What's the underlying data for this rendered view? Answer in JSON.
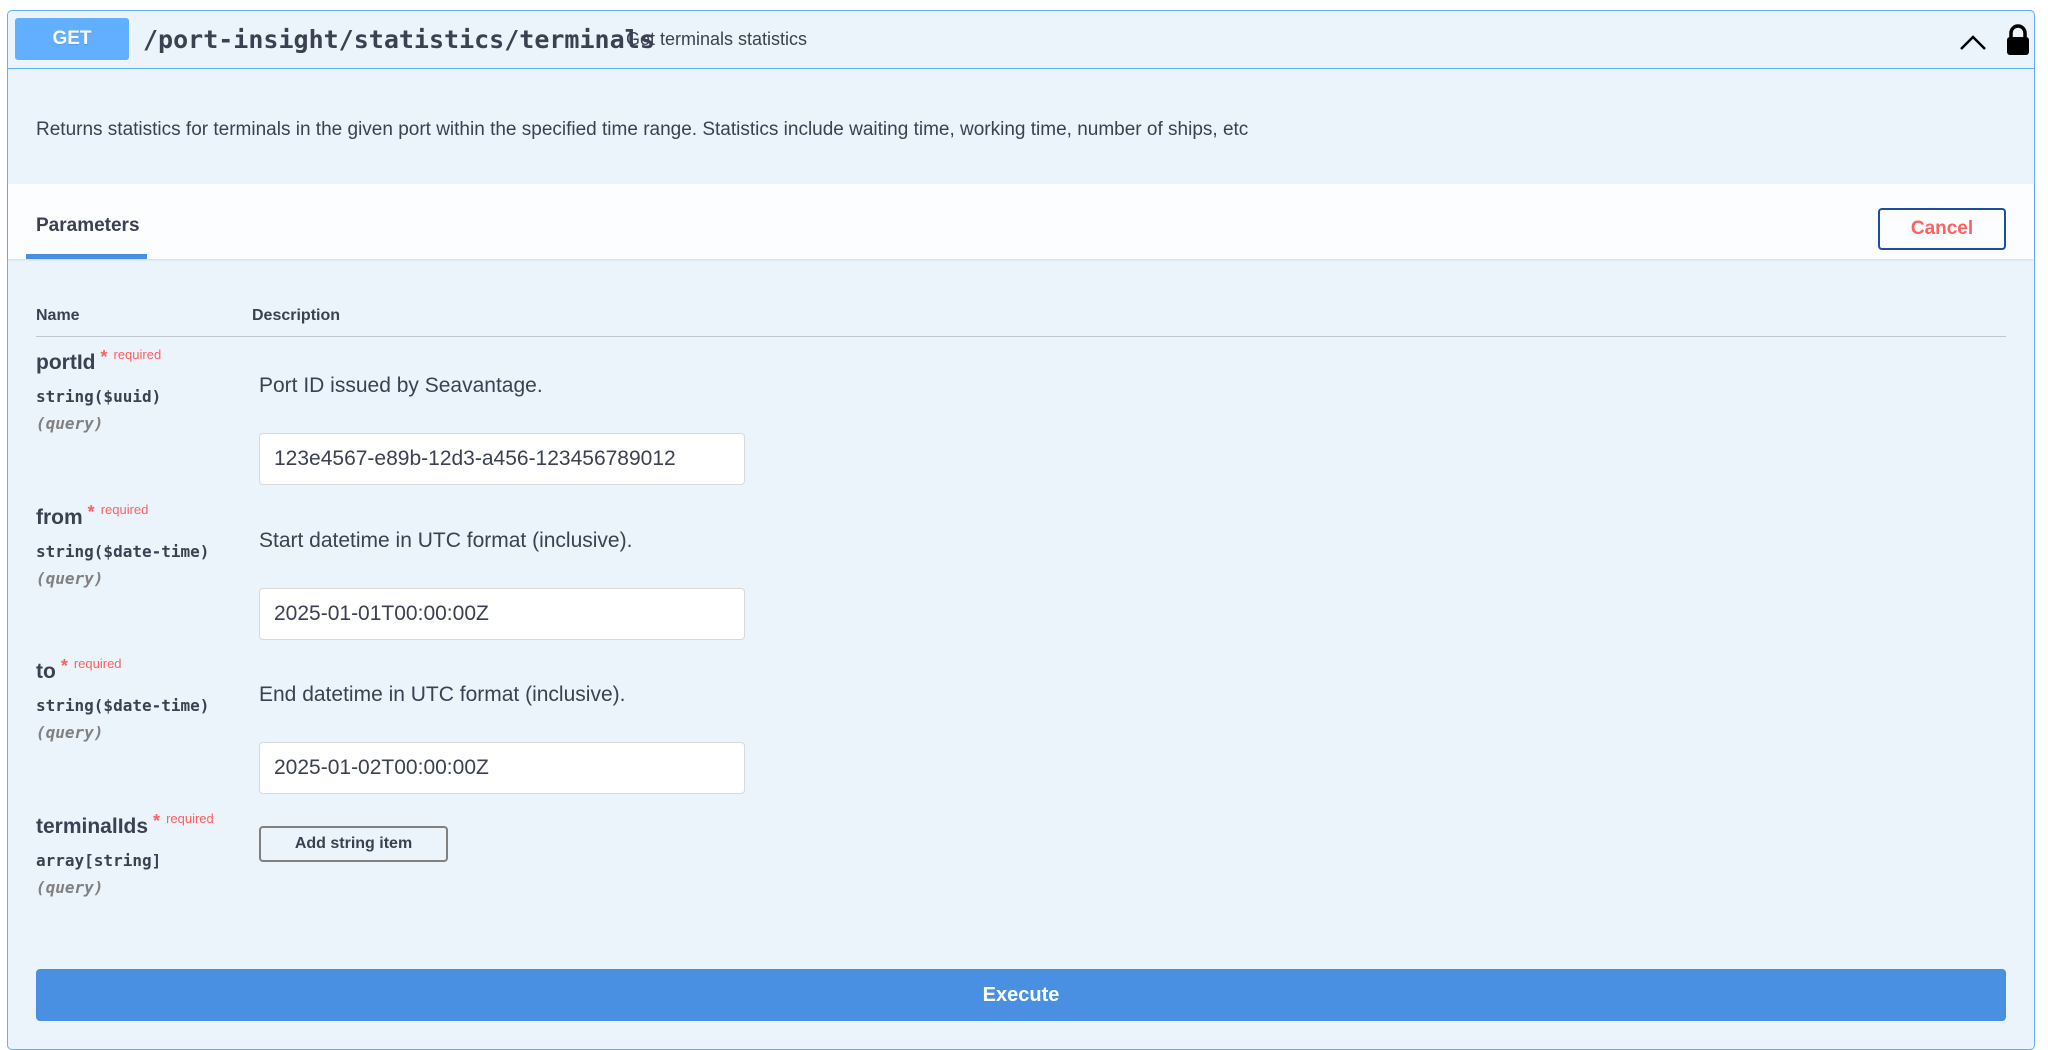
{
  "endpoint": {
    "method": "GET",
    "path": "/port-insight/statistics/terminals",
    "summary": "Get terminals statistics",
    "description": "Returns statistics for terminals in the given port within the specified time range. Statistics include waiting time, working time, number of ships, etc",
    "icons": {
      "collapse": "chevron-up-icon",
      "auth": "lock-icon"
    }
  },
  "section": {
    "tab_label": "Parameters",
    "cancel_label": "Cancel",
    "columns": {
      "name": "Name",
      "description": "Description"
    }
  },
  "params": [
    {
      "name": "portId",
      "required_mark": "*",
      "required_label": "required",
      "type": "string($uuid)",
      "in": "(query)",
      "description": "Port ID issued by Seavantage.",
      "value": "123e4567-e89b-12d3-a456-123456789012"
    },
    {
      "name": "from",
      "required_mark": "*",
      "required_label": "required",
      "type": "string($date-time)",
      "in": "(query)",
      "description": "Start datetime in UTC format (inclusive).",
      "value": "2025-01-01T00:00:00Z"
    },
    {
      "name": "to",
      "required_mark": "*",
      "required_label": "required",
      "type": "string($date-time)",
      "in": "(query)",
      "description": "End datetime in UTC format (inclusive).",
      "value": "2025-01-02T00:00:00Z"
    },
    {
      "name": "terminalIds",
      "required_mark": "*",
      "required_label": "required",
      "type": "array[string]",
      "in": "(query)",
      "add_item_label": "Add string item"
    }
  ],
  "execute_label": "Execute",
  "colors": {
    "accent": "#61affe",
    "execute": "#4990e2",
    "required": "#ff6060",
    "panel_bg": "#ebf3fb"
  }
}
